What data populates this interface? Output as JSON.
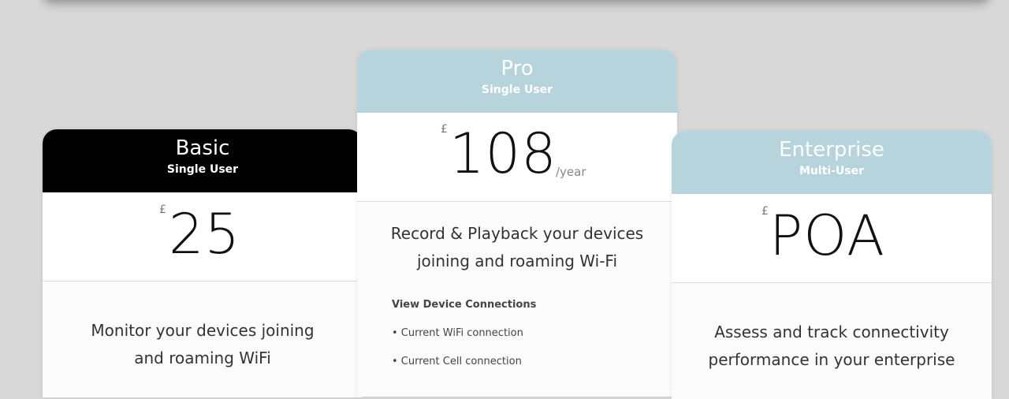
{
  "currency_symbol": "£",
  "colors": {
    "basic_header_bg": "#000000",
    "basic_header_text": "#ffffff",
    "pro_header_bg": "#b7d4dd",
    "pro_header_text": "#ffffff",
    "enterprise_header_bg": "#b7d4dd",
    "enterprise_header_text": "#ffffff"
  },
  "plans": [
    {
      "name": "Basic",
      "subtitle": "Single User",
      "price": "25",
      "period": "",
      "description_lines": [
        "Monitor your devices joining",
        "and roaming WiFi"
      ]
    },
    {
      "name": "Pro",
      "subtitle": "Single User",
      "price": "108",
      "period": "/year",
      "description_lines": [
        "Record & Playback your devices",
        "joining and roaming Wi-Fi"
      ],
      "features": [
        "View Device Connections",
        "• Current WiFi connection",
        "• Current Cell connection"
      ]
    },
    {
      "name": "Enterprise",
      "subtitle": "Multi-User",
      "price": "POA",
      "period": "",
      "description_lines": [
        "Assess and track connectivity",
        "performance in your enterprise"
      ]
    }
  ]
}
